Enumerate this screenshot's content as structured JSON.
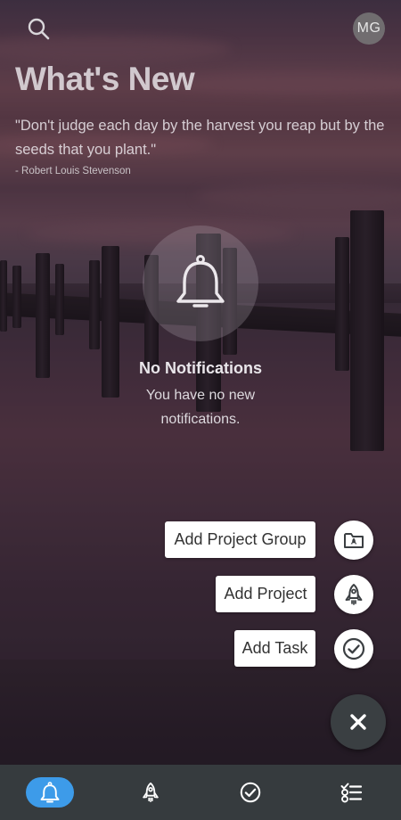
{
  "header": {
    "search_icon": "search-icon",
    "avatar_initials": "MG"
  },
  "page": {
    "title": "What's New",
    "quote": "\"Don't judge each day by the harvest you reap but by the seeds that you plant.\"",
    "quote_author": "- Robert Louis Stevenson"
  },
  "empty_state": {
    "icon": "bell-icon",
    "title": "No Notifications",
    "message": "You have no new notifications."
  },
  "speed_dial": {
    "items": [
      {
        "label": "Add Project Group",
        "icon": "folder-rocket-icon"
      },
      {
        "label": "Add Project",
        "icon": "rocket-icon"
      },
      {
        "label": "Add Task",
        "icon": "check-circle-icon"
      }
    ],
    "close_icon": "close-icon"
  },
  "bottom_nav": {
    "items": [
      {
        "name": "notifications",
        "icon": "bell-icon",
        "active": true
      },
      {
        "name": "projects",
        "icon": "rocket-icon",
        "active": false
      },
      {
        "name": "tasks",
        "icon": "check-circle-icon",
        "active": false
      },
      {
        "name": "checklist",
        "icon": "checklist-icon",
        "active": false
      }
    ]
  },
  "colors": {
    "accent": "#3d9be9",
    "nav_background": "#363b3e",
    "fab_background": "#3a3f42"
  }
}
